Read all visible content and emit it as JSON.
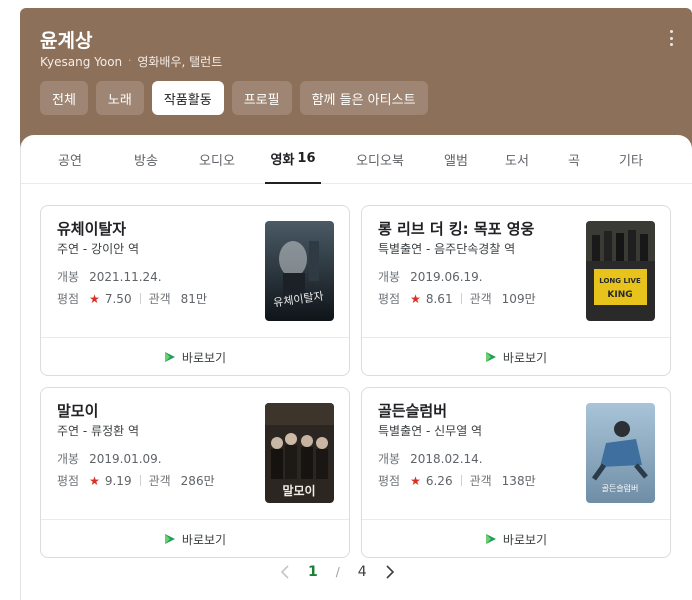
{
  "header": {
    "title": "윤계상",
    "name_en": "Kyesang Yoon",
    "description": "영화배우, 탤런트"
  },
  "chips": [
    {
      "label": "전체",
      "active": false
    },
    {
      "label": "노래",
      "active": false
    },
    {
      "label": "작품활동",
      "active": true
    },
    {
      "label": "프로필",
      "active": false
    },
    {
      "label": "함께 들은 아티스트",
      "active": false
    }
  ],
  "tabs": [
    {
      "label": "공연",
      "count": ""
    },
    {
      "label": "방송",
      "count": ""
    },
    {
      "label": "오디오",
      "count": ""
    },
    {
      "label": "영화",
      "count": "16"
    },
    {
      "label": "오디오북",
      "count": ""
    },
    {
      "label": "앨범",
      "count": ""
    },
    {
      "label": "도서",
      "count": ""
    },
    {
      "label": "곡",
      "count": ""
    },
    {
      "label": "기타",
      "count": ""
    }
  ],
  "movies": [
    {
      "title": "유체이탈자",
      "role": "주연 - 강이안 역",
      "release_label": "개봉",
      "release": "2021.11.24.",
      "rating_label": "평점",
      "rating": "7.50",
      "audience_label": "관객",
      "audience": "81만",
      "watch": "바로보기",
      "poster_text": "유체이탈자"
    },
    {
      "title": "롱 리브 더 킹: 목포 영웅",
      "role": "특별출연 - 음주단속경찰 역",
      "release_label": "개봉",
      "release": "2019.06.19.",
      "rating_label": "평점",
      "rating": "8.61",
      "audience_label": "관객",
      "audience": "109만",
      "watch": "바로보기",
      "poster_text": "LONG LIVE THE KING"
    },
    {
      "title": "말모이",
      "role": "주연 - 류정환 역",
      "release_label": "개봉",
      "release": "2019.01.09.",
      "rating_label": "평점",
      "rating": "9.19",
      "audience_label": "관객",
      "audience": "286만",
      "watch": "바로보기",
      "poster_text": "말모이"
    },
    {
      "title": "골든슬럼버",
      "role": "특별출연 - 신무열 역",
      "release_label": "개봉",
      "release": "2018.02.14.",
      "rating_label": "평점",
      "rating": "6.26",
      "audience_label": "관객",
      "audience": "138만",
      "watch": "바로보기",
      "poster_text": "골든슬럼버"
    }
  ],
  "pager": {
    "current": "1",
    "separator": "/",
    "total": "4"
  },
  "colors": {
    "header_bg": "#8c705a",
    "chip_bg": "#9f8674",
    "star": "#d93025",
    "play": "#1e9e57",
    "page_active": "#1a7f37"
  }
}
